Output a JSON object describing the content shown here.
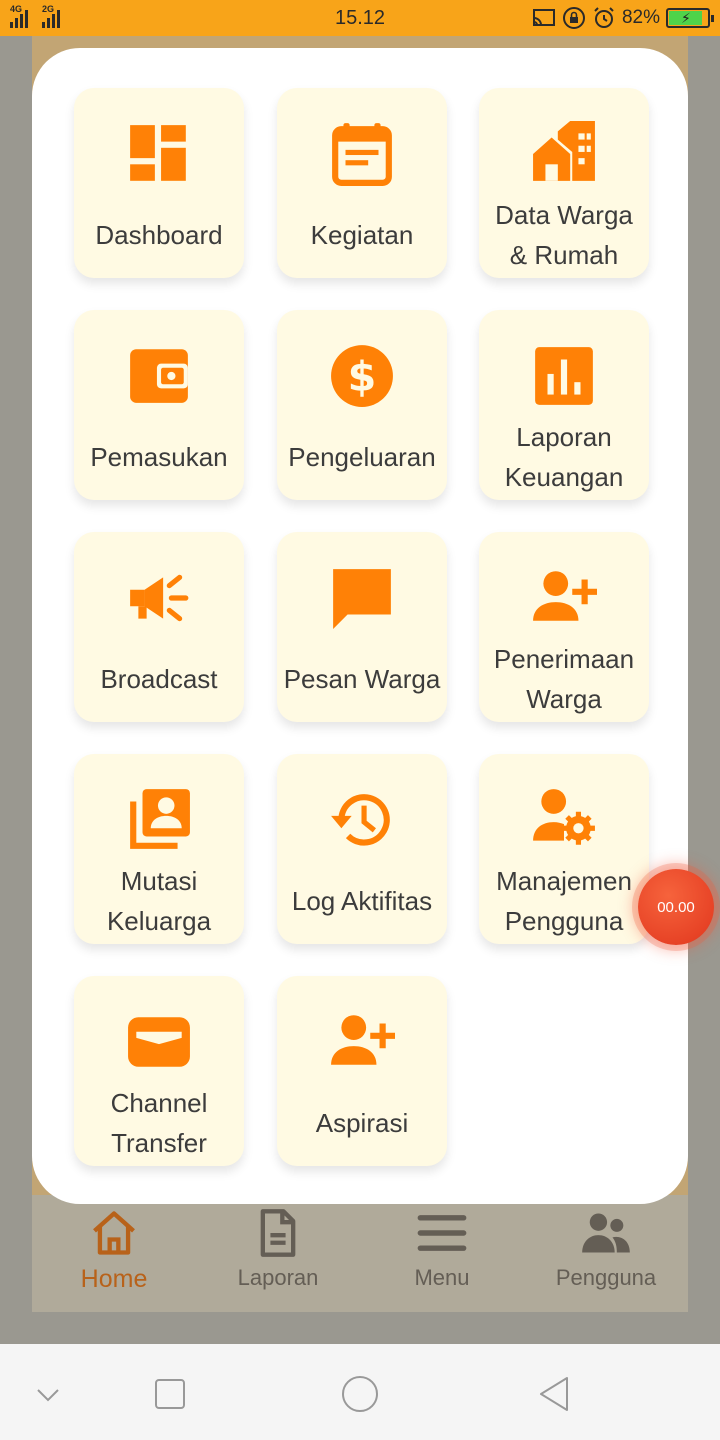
{
  "status_bar": {
    "network_1": "4G",
    "network_2": "2G",
    "time": "15.12",
    "battery_percent": "82%",
    "battery_level": 0.82,
    "icons": [
      "cast-icon",
      "lock-rotation-icon",
      "alarm-icon",
      "battery-charging-icon"
    ]
  },
  "menu": {
    "items": [
      {
        "label": "Dashboard",
        "icon": "dashboard-icon"
      },
      {
        "label": "Kegiatan",
        "icon": "calendar-event-icon"
      },
      {
        "label": "Data Warga & Rumah",
        "icon": "houses-icon"
      },
      {
        "label": "Pemasukan",
        "icon": "wallet-icon"
      },
      {
        "label": "Pengeluaran",
        "icon": "dollar-icon"
      },
      {
        "label": "Laporan Keuangan",
        "icon": "bar-chart-icon"
      },
      {
        "label": "Broadcast",
        "icon": "megaphone-icon"
      },
      {
        "label": "Pesan Warga",
        "icon": "chat-icon"
      },
      {
        "label": "Penerimaan Warga",
        "icon": "person-add-icon"
      },
      {
        "label": "Mutasi Keluarga",
        "icon": "contacts-stack-icon"
      },
      {
        "label": "Log Aktifitas",
        "icon": "history-icon"
      },
      {
        "label": "Manajemen Pengguna",
        "icon": "user-gear-icon"
      },
      {
        "label": "Channel Transfer",
        "icon": "card-wallet-icon"
      },
      {
        "label": "Aspirasi",
        "icon": "person-add-icon"
      }
    ]
  },
  "bottom_nav": {
    "items": [
      {
        "label": "Home",
        "icon": "home-icon",
        "active": true
      },
      {
        "label": "Laporan",
        "icon": "document-icon",
        "active": false
      },
      {
        "label": "Menu",
        "icon": "hamburger-icon",
        "active": false
      },
      {
        "label": "Pengguna",
        "icon": "users-icon",
        "active": false
      }
    ]
  },
  "float_timer": {
    "text": "00.00"
  },
  "colors": {
    "accent": "#ff8106",
    "status_bar": "#f8a419",
    "card_bg": "#fffae3",
    "active_nav": "#b8621a",
    "timer": "#e73c22"
  }
}
